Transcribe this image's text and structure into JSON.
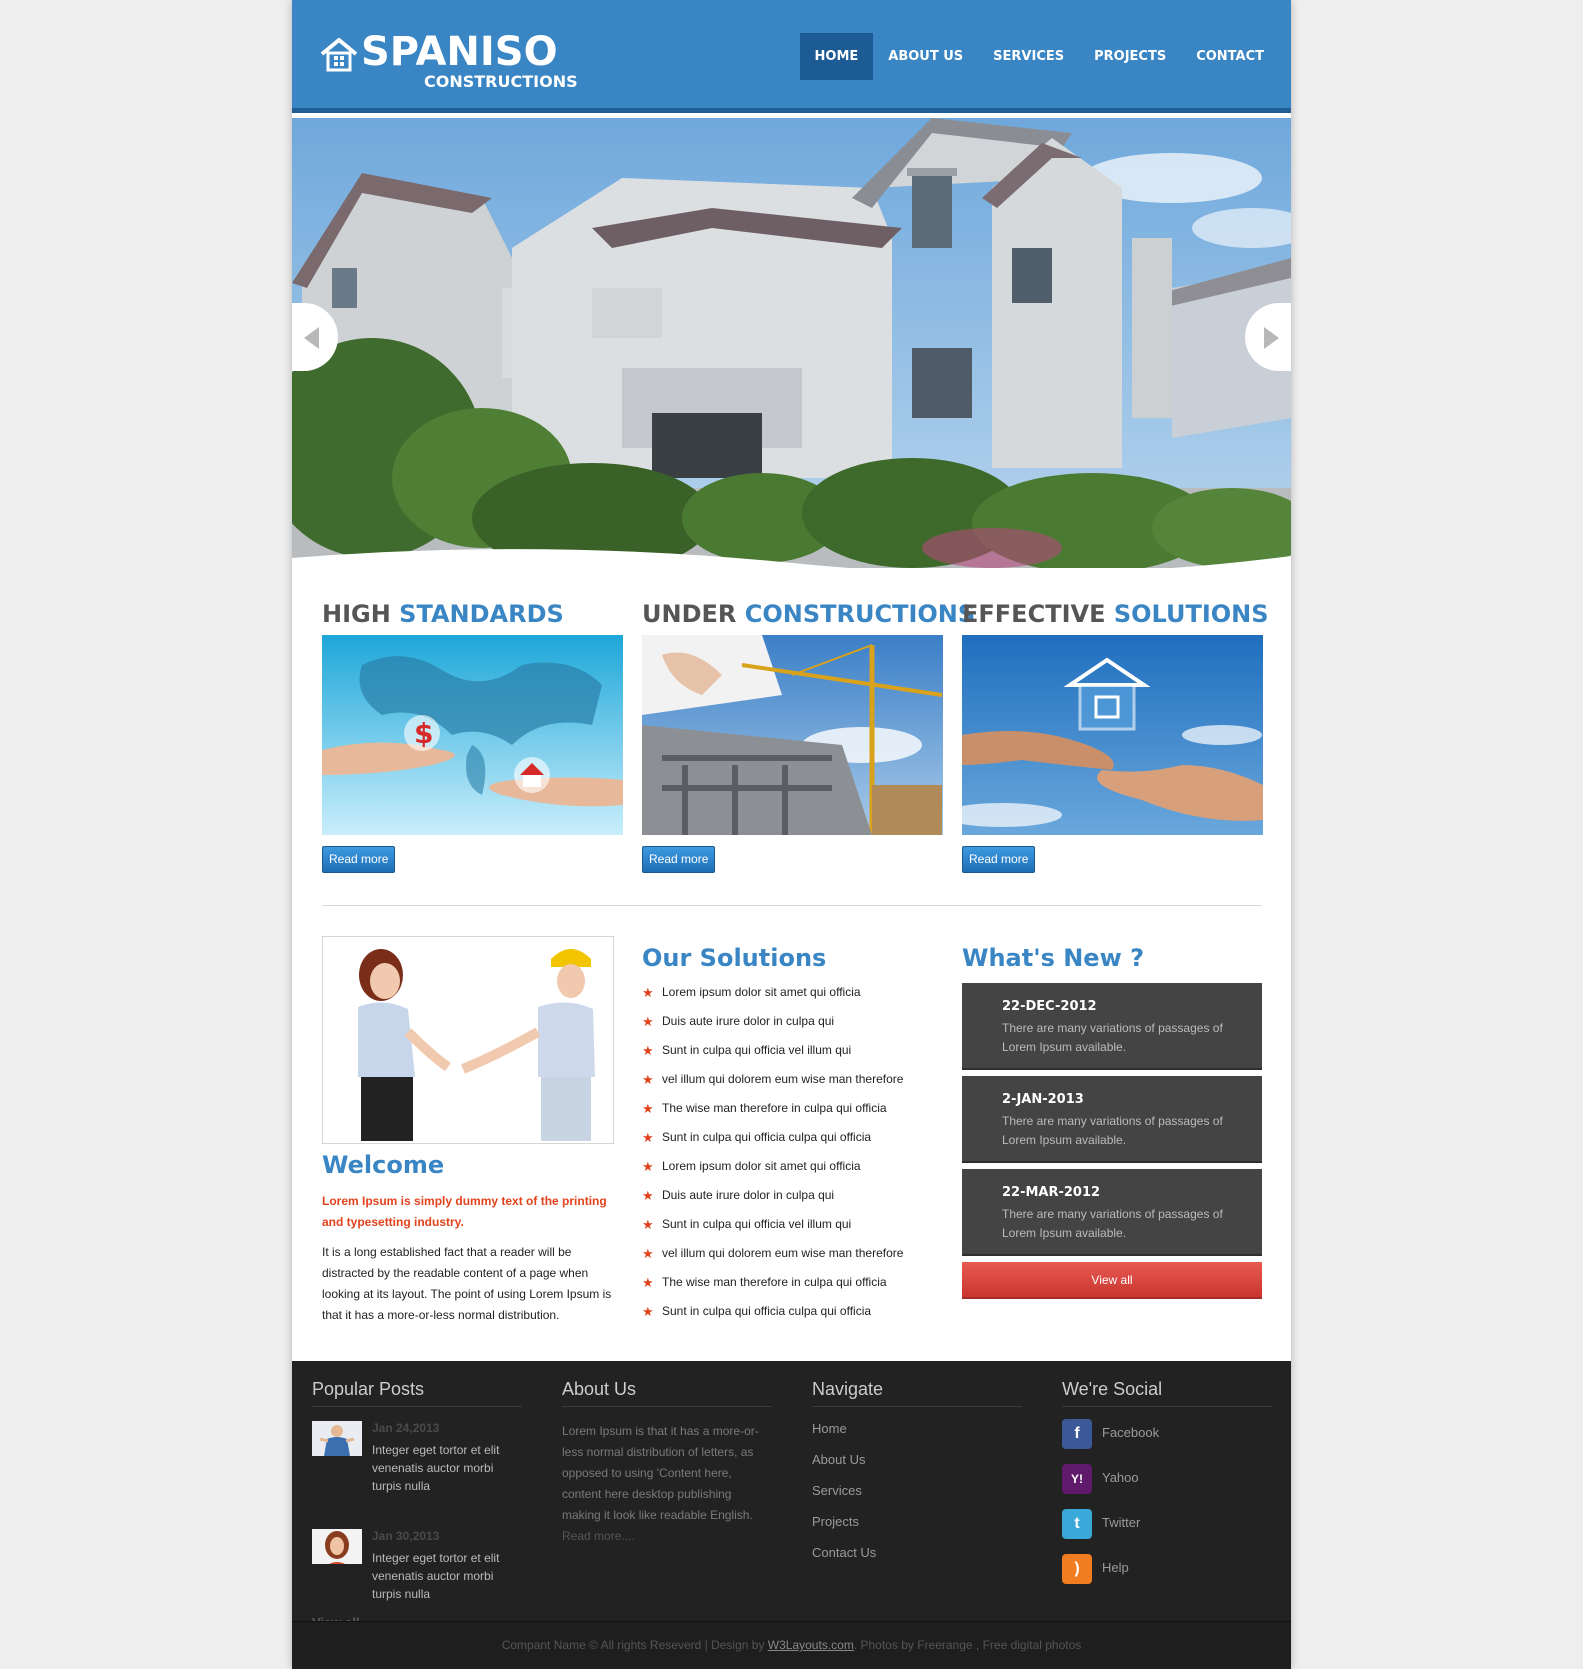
{
  "brand": {
    "name": "SPANISO",
    "tagline": "CONSTRUCTIONS"
  },
  "nav": {
    "items": [
      {
        "label": "HOME",
        "active": true
      },
      {
        "label": "ABOUT US"
      },
      {
        "label": "SERVICES"
      },
      {
        "label": "PROJECTS"
      },
      {
        "label": "CONTACT"
      }
    ]
  },
  "features": [
    {
      "title": "HIGH",
      "highlight": "STANDARDS",
      "button": "Read more"
    },
    {
      "title": "UNDER",
      "highlight": "CONSTRUCTIONS",
      "button": "Read more"
    },
    {
      "title": "EFFECTIVE",
      "highlight": "SOLUTIONS",
      "button": "Read more"
    }
  ],
  "welcome": {
    "title": "Welcome",
    "lead": "Lorem Ipsum is simply dummy text of the printing and typesetting industry.",
    "text": "It is a long established fact that a reader will be distracted by the readable content of a page when looking at its layout. The point of using Lorem Ipsum is that it has a more-or-less normal distribution."
  },
  "solutions": {
    "title": "Our Solutions",
    "items": [
      "Lorem ipsum dolor sit amet qui officia",
      "Duis aute irure dolor in culpa qui",
      "Sunt in culpa qui officia vel illum qui",
      "vel illum qui dolorem eum wise man therefore",
      "The wise man therefore in culpa qui officia",
      "Sunt in culpa qui officia culpa qui officia",
      "Lorem ipsum dolor sit amet qui officia",
      "Duis aute irure dolor in culpa qui",
      "Sunt in culpa qui officia vel illum qui",
      "vel illum qui dolorem eum wise man therefore",
      "The wise man therefore in culpa qui officia",
      "Sunt in culpa qui officia culpa qui officia"
    ]
  },
  "news": {
    "title": "What's New ?",
    "items": [
      {
        "date": "22-DEC-2012",
        "text": "There are many variations of passages of Lorem Ipsum available."
      },
      {
        "date": "2-JAN-2013",
        "text": "There are many variations of passages of Lorem Ipsum available."
      },
      {
        "date": "22-MAR-2012",
        "text": "There are many variations of passages of Lorem Ipsum available."
      }
    ],
    "view_all": "View all"
  },
  "footer": {
    "popular": {
      "title": "Popular Posts",
      "posts": [
        {
          "date": "Jan 24,2013",
          "text": "Integer eget tortor et elit venenatis auctor morbi turpis nulla"
        },
        {
          "date": "Jan 30,2013",
          "text": "Integer eget tortor et elit venenatis auctor morbi turpis nulla"
        }
      ],
      "view_all": "View all"
    },
    "about": {
      "title": "About Us",
      "text": "Lorem Ipsum is that it has a more-or-less normal distribution of letters, as opposed to using 'Content here, content here desktop publishing making it look like readable English.",
      "more": "Read more...."
    },
    "navigate": {
      "title": "Navigate",
      "links": [
        "Home",
        "About Us",
        "Services",
        "Projects",
        "Contact Us"
      ]
    },
    "social": {
      "title": "We're Social",
      "items": [
        {
          "label": "Facebook",
          "icon": "facebook-icon",
          "color": "#3b5998",
          "glyph": "f"
        },
        {
          "label": "Yahoo",
          "icon": "yahoo-icon",
          "color": "#5f1a6b",
          "glyph": "Y!"
        },
        {
          "label": "Twitter",
          "icon": "twitter-icon",
          "color": "#3aa8d8",
          "glyph": "t"
        },
        {
          "label": "Help",
          "icon": "rss-icon",
          "color": "#f07d1f",
          "glyph": ")"
        }
      ]
    },
    "copyright": {
      "prefix": "Compant Name © All rights Reseverd | Design by ",
      "link": "W3Layouts.com",
      "suffix": ". Photos by Freerange , Free digital photos"
    }
  },
  "colors": {
    "primary": "#3a86c4",
    "accent": "#e2421c",
    "dark": "#222222"
  }
}
